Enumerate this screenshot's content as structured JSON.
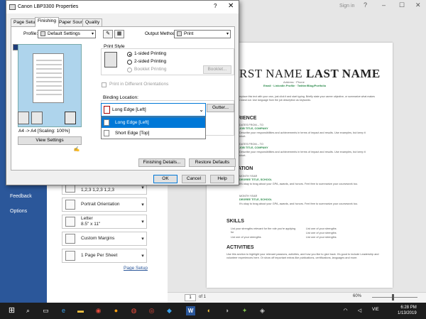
{
  "window": {
    "signin": "Sign in",
    "controls": [
      "?",
      "–",
      "☐",
      "✕"
    ]
  },
  "backstage": {
    "left_items": [
      "Feedback",
      "Options"
    ],
    "options": [
      {
        "line1": "Collated",
        "line2": "1,2,3   1,2,3   1,2,3"
      },
      {
        "line1": "Portrait Orientation",
        "line2": ""
      },
      {
        "line1": "Letter",
        "line2": "8.5\" x 11\""
      },
      {
        "line1": "Custom Margins",
        "line2": ""
      },
      {
        "line1": "1 Page Per Sheet",
        "line2": ""
      }
    ],
    "page_setup": "Page Setup"
  },
  "document": {
    "name_first": "RST NAME",
    "name_last": "LAST NAME",
    "address": "Address · Phone",
    "links": "Email · LinkedIn Profile · Twitter/Blog/Portfolio",
    "intro": "To replace this text with your own, just click it and start typing. Briefly state your career objective, or summarize what makes you stand out. Use language from the job description as keywords.",
    "experience_heading": "RIENCE",
    "exp_dates": "DATES FROM – TO",
    "exp_title": "JOB TITLE, COMPANY",
    "exp_desc": "Describe your responsibilities and achievements in terms of impact and results. Use examples, but keep it short.",
    "education_heading": "ATION",
    "edu_year": "MONTH YEAR",
    "edu_degree": "DEGREE TITLE, SCHOOL",
    "edu_desc": "It's okay to brag about your GPA, awards, and honors. Feel free to summarize your coursework too.",
    "skills_heading": "SKILLS",
    "skills_left": [
      "List your strengths relevant for the role you're applying for",
      "List one of your strengths"
    ],
    "skills_right": [
      "List one of your strengths",
      "List one of your strengths",
      "List one of your strengths"
    ],
    "activities_heading": "ACTIVITIES",
    "activities_desc": "Use this section to highlight your relevant passions, activities, and how you like to give back. It's good to include Leadership and volunteer experiences here. Or show off important extras like publications, certifications, languages and more."
  },
  "status": {
    "page": "1",
    "of": "of 1",
    "zoom": "60%"
  },
  "dialog": {
    "title": "Canon LBP3300 Properties",
    "help": "?",
    "close": "✕",
    "tabs": [
      "Page Setup",
      "Finishing",
      "Paper Source",
      "Quality"
    ],
    "profile_label": "Profile:",
    "profile_value": "Default Settings",
    "output_label": "Output Method:",
    "output_value": "Print",
    "scale_label": "A4 -> A4 [Scaling: 100%]",
    "view_settings": "View Settings",
    "print_style_label": "Print Style",
    "print_styles": [
      "1-sided Printing",
      "2-sided Printing",
      "Booklet Printing"
    ],
    "booklet_button": "Booklet...",
    "different_orientations": "Print in Different Orientations",
    "binding_label": "Binding Location:",
    "binding_value": "Long Edge [Left]",
    "gutter_button": "Gutter...",
    "binding_options": [
      "Long Edge [Left]",
      "Short Edge [Top]"
    ],
    "finishing_details": "Finishing Details...",
    "restore_defaults": "Restore Defaults",
    "ok": "OK",
    "cancel": "Cancel",
    "help_button": "Help"
  },
  "taskbar": {
    "lang": "VIE",
    "time": "6:28 PM",
    "date": "1/13/2019"
  }
}
